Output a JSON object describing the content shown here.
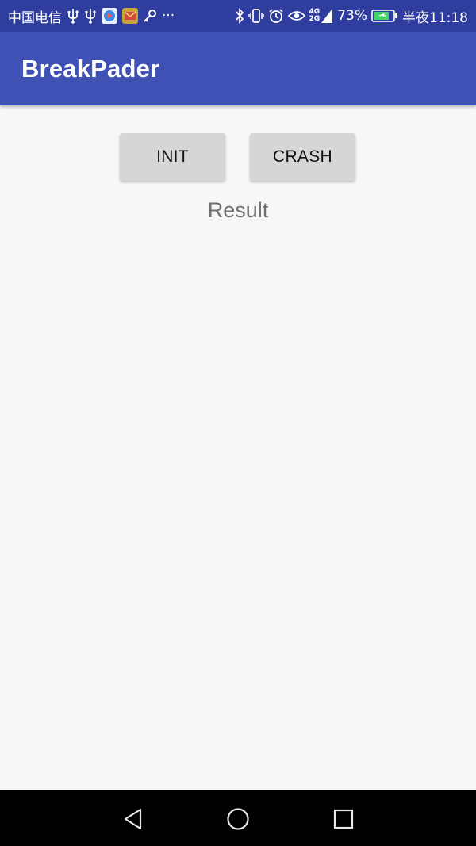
{
  "status_bar": {
    "carrier": "中国电信",
    "more_indicator": "···",
    "signal_label_top": "4G",
    "signal_label_bottom": "2G",
    "battery_percent": "73%",
    "time": "半夜11:18",
    "icons": [
      "usb-icon",
      "usb-icon",
      "video-app-icon",
      "mail-app-icon",
      "key-icon",
      "bluetooth-icon",
      "vibrate-icon",
      "alarm-icon",
      "eye-icon",
      "signal-icon",
      "battery-icon"
    ],
    "colors": {
      "background": "#2f3e9e",
      "battery_fill": "#3dd66b"
    }
  },
  "app_bar": {
    "title": "BreakPader",
    "color": "#3f51b5"
  },
  "main": {
    "init_button_label": "INIT",
    "crash_button_label": "CRASH",
    "result_text": "Result"
  },
  "nav_bar": {
    "icons": [
      "back-icon",
      "home-icon",
      "recent-apps-icon"
    ]
  }
}
